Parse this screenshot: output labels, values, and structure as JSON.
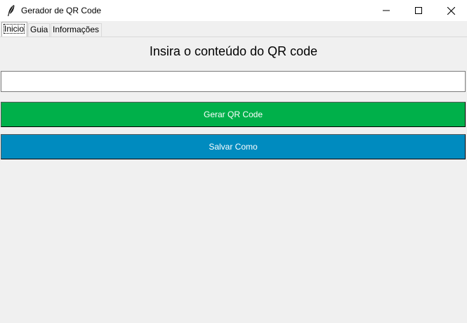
{
  "window": {
    "title": "Gerador de QR Code",
    "icon": "feather-icon"
  },
  "tabs": [
    {
      "label": "Inicio",
      "selected": true
    },
    {
      "label": "Guia",
      "selected": false
    },
    {
      "label": "Informações",
      "selected": false
    }
  ],
  "main": {
    "heading": "Insira o conteúdo do QR code",
    "input_value": "",
    "buttons": [
      {
        "label": "Gerar QR Code",
        "color": "#00b04a"
      },
      {
        "label": "Salvar Como",
        "color": "#008bbf"
      }
    ]
  }
}
